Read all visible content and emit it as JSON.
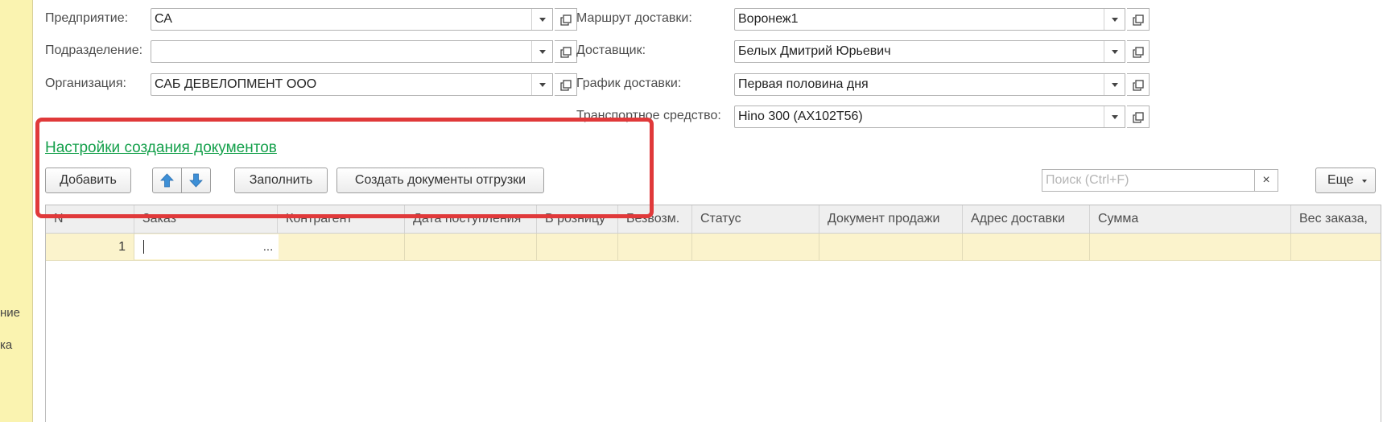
{
  "left_strip": {
    "items": [
      "ние",
      "ка"
    ]
  },
  "form": {
    "enterprise": {
      "label": "Предприятие:",
      "value": "СА"
    },
    "division": {
      "label": "Подразделение:",
      "value": ""
    },
    "organization": {
      "label": "Организация:",
      "value": "САБ ДЕВЕЛОПМЕНТ ООО"
    },
    "route": {
      "label": "Маршрут доставки:",
      "value": "Воронеж1"
    },
    "deliverer": {
      "label": "Доставщик:",
      "value": "Белых Дмитрий Юрьевич"
    },
    "schedule": {
      "label": "График доставки:",
      "value": "Первая половина дня"
    },
    "vehicle": {
      "label": "Транспортное средство:",
      "value": "Hino 300 (АХ102Т56)"
    }
  },
  "settings_link": "Настройки создания документов",
  "toolbar": {
    "add": "Добавить",
    "up_icon": "arrow-up-icon",
    "down_icon": "arrow-down-icon",
    "fill": "Заполнить",
    "create_shipping": "Создать документы отгрузки",
    "search_placeholder": "Поиск (Ctrl+F)",
    "clear": "×",
    "more": "Еще"
  },
  "table": {
    "columns": [
      "N",
      "Заказ",
      "Контрагент",
      "Дата поступления",
      "В розницу",
      "Безвозм.",
      "Статус",
      "Документ продажи",
      "Адрес доставки",
      "Сумма",
      "Вес заказа,"
    ],
    "rows": [
      {
        "n": "1",
        "order": "",
        "ellipsis": "..."
      }
    ]
  },
  "colors": {
    "accent_link": "#14a04b",
    "highlight_row": "#fbf3cc",
    "annotation": "#e0393a",
    "side_panel": "#faf3b0"
  }
}
